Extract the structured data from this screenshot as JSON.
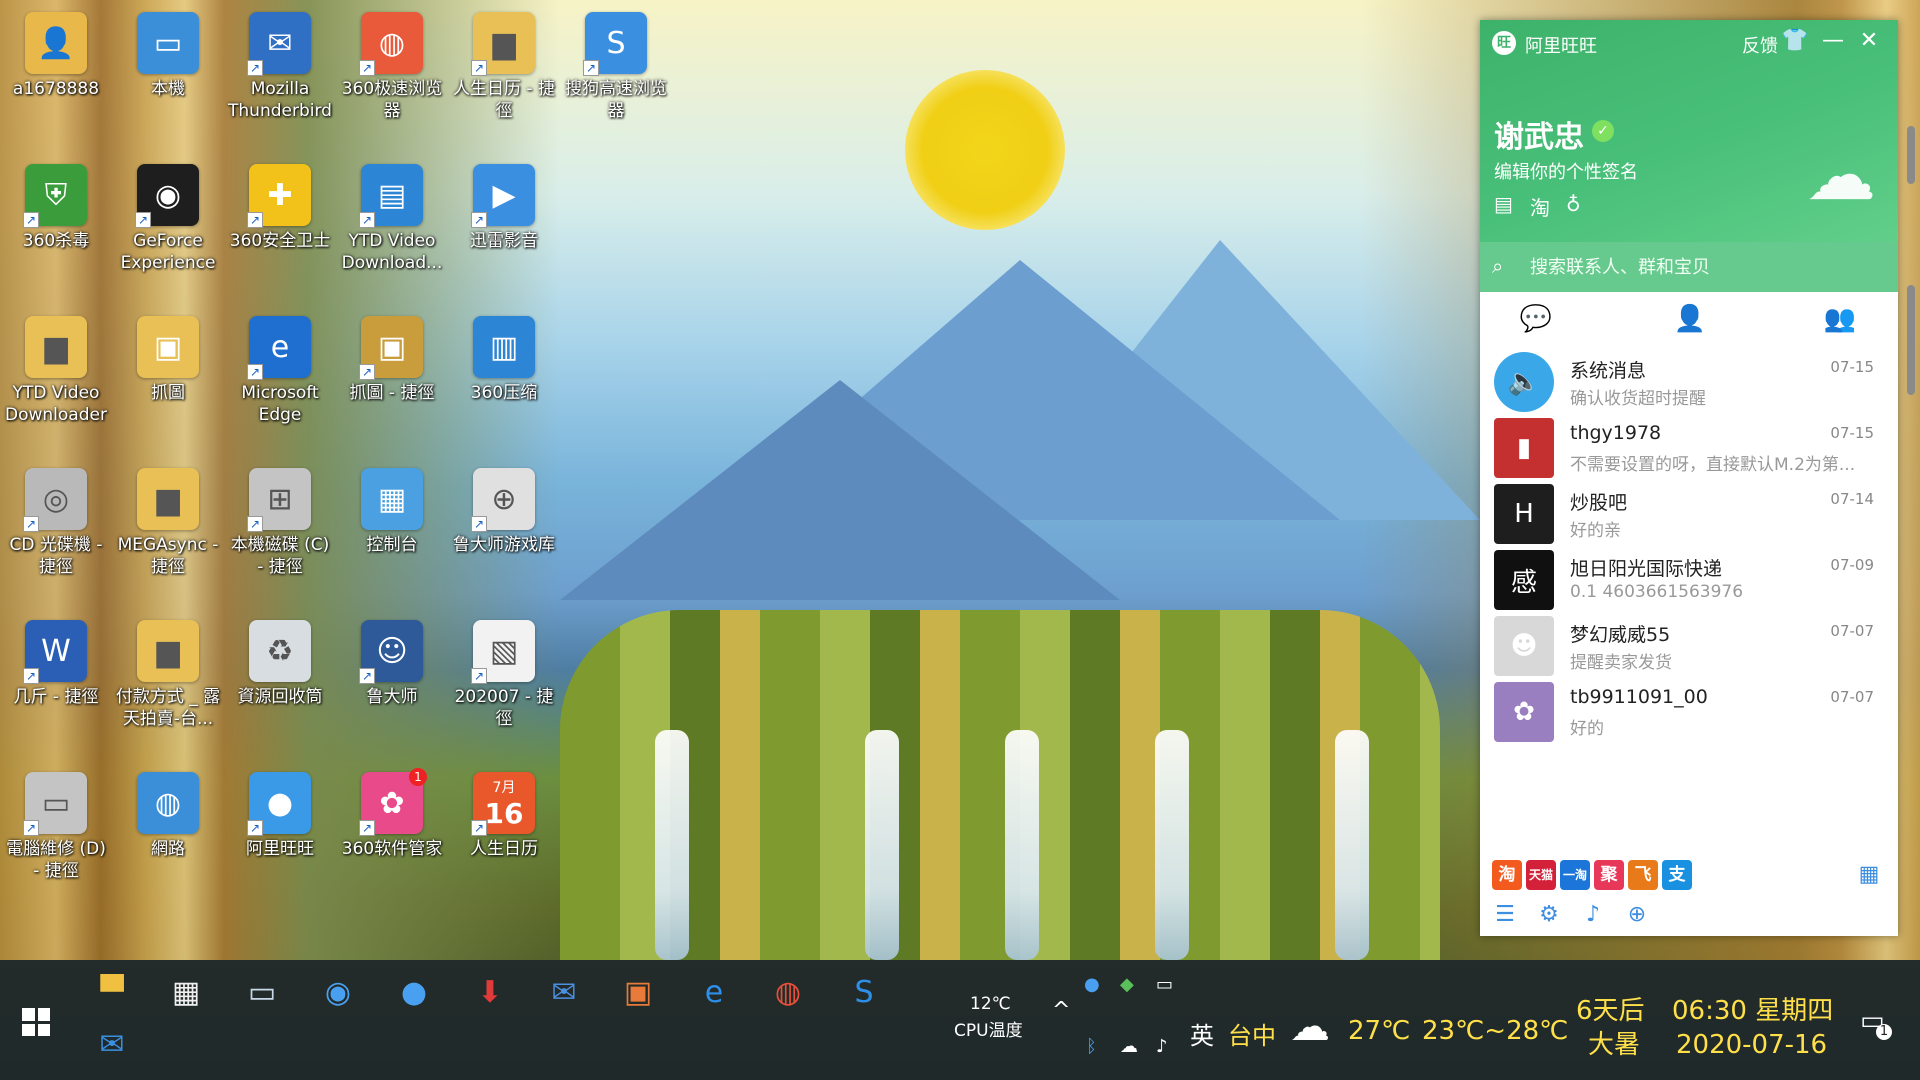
{
  "desktop": {
    "icons": [
      {
        "label": "a1678888",
        "icon": "user-folder-icon",
        "color": "#e8b84a"
      },
      {
        "label": "360杀毒",
        "icon": "shield-icon",
        "color": "#3a9c3a"
      },
      {
        "label": "YTD Video Downloader",
        "icon": "folder-icon",
        "color": "#e8c056"
      },
      {
        "label": "CD 光碟機 - 捷徑",
        "icon": "cd-drive-icon",
        "color": "#b9b9b9"
      },
      {
        "label": "几斤 - 捷徑",
        "icon": "word-doc-icon",
        "color": "#2b5fb5"
      },
      {
        "label": "電腦維修 (D) - 捷徑",
        "icon": "drive-icon",
        "color": "#c4c4c4"
      },
      {
        "label": "本機",
        "icon": "computer-icon",
        "color": "#3a8fd8"
      },
      {
        "label": "GeForce Experience",
        "icon": "nvidia-icon",
        "color": "#1e1e1e"
      },
      {
        "label": "抓圖",
        "icon": "image-folder-icon",
        "color": "#e8c056"
      },
      {
        "label": "MEGAsync - 捷徑",
        "icon": "folder-icon",
        "color": "#e8c056"
      },
      {
        "label": "付款方式 _ 露天拍賣-台...",
        "icon": "folder-icon",
        "color": "#e8c056"
      },
      {
        "label": "網路",
        "icon": "network-icon",
        "color": "#3a8fd8"
      },
      {
        "label": "Mozilla Thunderbird",
        "icon": "thunderbird-icon",
        "color": "#2f6fc4"
      },
      {
        "label": "360安全卫士",
        "icon": "plus-icon",
        "color": "#f2c21a"
      },
      {
        "label": "Microsoft Edge",
        "icon": "edge-icon",
        "color": "#1f6fd0"
      },
      {
        "label": "本機磁碟 (C) - 捷徑",
        "icon": "windows-drive-icon",
        "color": "#c4c4c4"
      },
      {
        "label": "資源回收筒",
        "icon": "recycle-bin-icon",
        "color": "#d8dde2"
      },
      {
        "label": "阿里旺旺",
        "icon": "wangwang-icon",
        "color": "#3a9ae8"
      },
      {
        "label": "360极速浏览器",
        "icon": "browser-icon",
        "color": "#e85a3a"
      },
      {
        "label": "YTD Video Download...",
        "icon": "zip-icon",
        "color": "#2d85d6"
      },
      {
        "label": "抓圖 - 捷徑",
        "icon": "image-folder-icon",
        "color": "#c99c3c"
      },
      {
        "label": "控制台",
        "icon": "control-panel-icon",
        "color": "#4aa0e0"
      },
      {
        "label": "鲁大师",
        "icon": "master-lu-icon",
        "color": "#2e5a9a"
      },
      {
        "label": "360软件管家",
        "icon": "apps-icon",
        "color": "#e84a8a"
      },
      {
        "label": "人生日历 - 捷徑",
        "icon": "folder-icon",
        "color": "#e8c056"
      },
      {
        "label": "迅雷影音",
        "icon": "play-icon",
        "color": "#3a8fe0"
      },
      {
        "label": "360压缩",
        "icon": "archive-icon",
        "color": "#2d85d6"
      },
      {
        "label": "鲁大师游戏库",
        "icon": "gamepad-icon",
        "color": "#e0e0e0"
      },
      {
        "label": "202007 - 捷徑",
        "icon": "image-file-icon",
        "color": "#f2f2f2"
      },
      {
        "label": "人生日历",
        "icon": "calendar-icon",
        "color": "#e8582a"
      },
      {
        "label": "搜狗高速浏览器",
        "icon": "sogou-icon",
        "color": "#3a8fe0"
      }
    ],
    "calendar_month": "7月",
    "calendar_day": "16",
    "badge_count": "1"
  },
  "wangwang": {
    "title": "阿里旺旺",
    "feedback": "反馈",
    "user_name": "谢武忠",
    "signature": "编辑你的个性签名",
    "search_placeholder": "搜索联系人、群和宝贝",
    "conversations": [
      {
        "name": "系统消息",
        "date": "07-15",
        "message": "确认收货超时提醒",
        "avatar_color": "#3aa8e8",
        "avatar_icon": "speaker-icon"
      },
      {
        "name": "thgy1978",
        "date": "07-15",
        "message": "不需要设置的呀，直接默认M.2为第...",
        "avatar_color": "#c43030",
        "avatar_icon": "product-icon"
      },
      {
        "name": "炒股吧",
        "date": "07-14",
        "message": "好的亲",
        "avatar_color": "#1e1e1e",
        "avatar_icon": "logo-h-icon"
      },
      {
        "name": "旭日阳光国际快递",
        "date": "07-09",
        "message": "0.1 4603661563976",
        "avatar_color": "#101010",
        "avatar_icon": "express-icon"
      },
      {
        "name": "梦幻威威55",
        "date": "07-07",
        "message": "提醒卖家发货",
        "avatar_color": "#d8d8d8",
        "avatar_icon": "cartoon-icon"
      },
      {
        "name": "tb9911091_00",
        "date": "07-07",
        "message": "好的",
        "avatar_color": "#9a7fc0",
        "avatar_icon": "flower-icon"
      }
    ],
    "apps": [
      {
        "label": "淘",
        "color": "#f25a1e"
      },
      {
        "label": "天猫",
        "color": "#d4213a"
      },
      {
        "label": "一淘",
        "color": "#1c75d8"
      },
      {
        "label": "聚",
        "color": "#e8385a"
      },
      {
        "label": "飞",
        "color": "#e87a1a"
      },
      {
        "label": "支",
        "color": "#1a90e0"
      }
    ]
  },
  "taskbar": {
    "cpu_temp": "12℃",
    "cpu_label": "CPU温度",
    "ime_lang": "英",
    "location": "台中",
    "current_temp": "27℃",
    "temp_range": "23℃~28℃",
    "days_until": "6天后",
    "solar_term": "大暑",
    "time_weekday": "06:30 星期四",
    "date": "2020-07-16",
    "notification_count": "1"
  }
}
